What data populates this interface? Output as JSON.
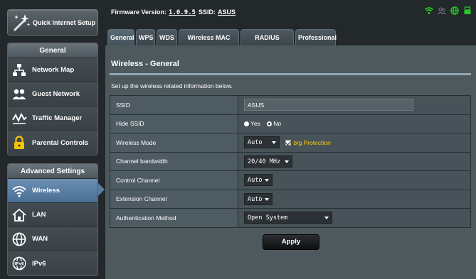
{
  "sidebar": {
    "quick_setup_label": "Quick Internet Setup",
    "general": {
      "header": "General",
      "items": [
        {
          "label": "Network Map",
          "icon": "network-map-icon"
        },
        {
          "label": "Guest Network",
          "icon": "guest-network-icon"
        },
        {
          "label": "Traffic Manager",
          "icon": "traffic-manager-icon"
        },
        {
          "label": "Parental Controls",
          "icon": "parental-controls-icon"
        }
      ]
    },
    "advanced": {
      "header": "Advanced Settings",
      "items": [
        {
          "label": "Wireless",
          "icon": "wifi-icon",
          "active": true
        },
        {
          "label": "LAN",
          "icon": "home-icon"
        },
        {
          "label": "WAN",
          "icon": "globe-icon"
        },
        {
          "label": "IPv6",
          "icon": "ipv6-icon"
        }
      ]
    }
  },
  "topbar": {
    "firmware_label": "Firmware Version:",
    "firmware_value": "1.0.9.5",
    "ssid_label": "SSID:",
    "ssid_value": "ASUS",
    "status_icons": [
      "wifi-status-icon",
      "users-status-icon",
      "internet-status-icon",
      "usb-status-icon"
    ],
    "accent_color": "#22cc22"
  },
  "tabs": [
    "General",
    "WPS",
    "WDS",
    "Wireless MAC Filter",
    "RADIUS Setting",
    "Professional"
  ],
  "active_tab": "General",
  "main": {
    "title": "Wireless - General",
    "description": "Set up the wireless related information below.",
    "rows": {
      "ssid": {
        "label": "SSID",
        "value": "ASUS"
      },
      "hide_ssid": {
        "label": "Hide SSID",
        "yes": "Yes",
        "no": "No",
        "selected": "No"
      },
      "wireless_mode": {
        "label": "Wireless Mode",
        "value": "Auto",
        "checkbox_label": "b/g Protection",
        "checked": true
      },
      "channel_bandwidth": {
        "label": "Channel bandwidth",
        "value": "20/40 MHz"
      },
      "control_channel": {
        "label": "Control Channel",
        "value": "Auto"
      },
      "extension_channel": {
        "label": "Extension Channel",
        "value": "Auto"
      },
      "auth_method": {
        "label": "Authentication Method",
        "value": "Open System"
      }
    },
    "apply_label": "Apply"
  }
}
